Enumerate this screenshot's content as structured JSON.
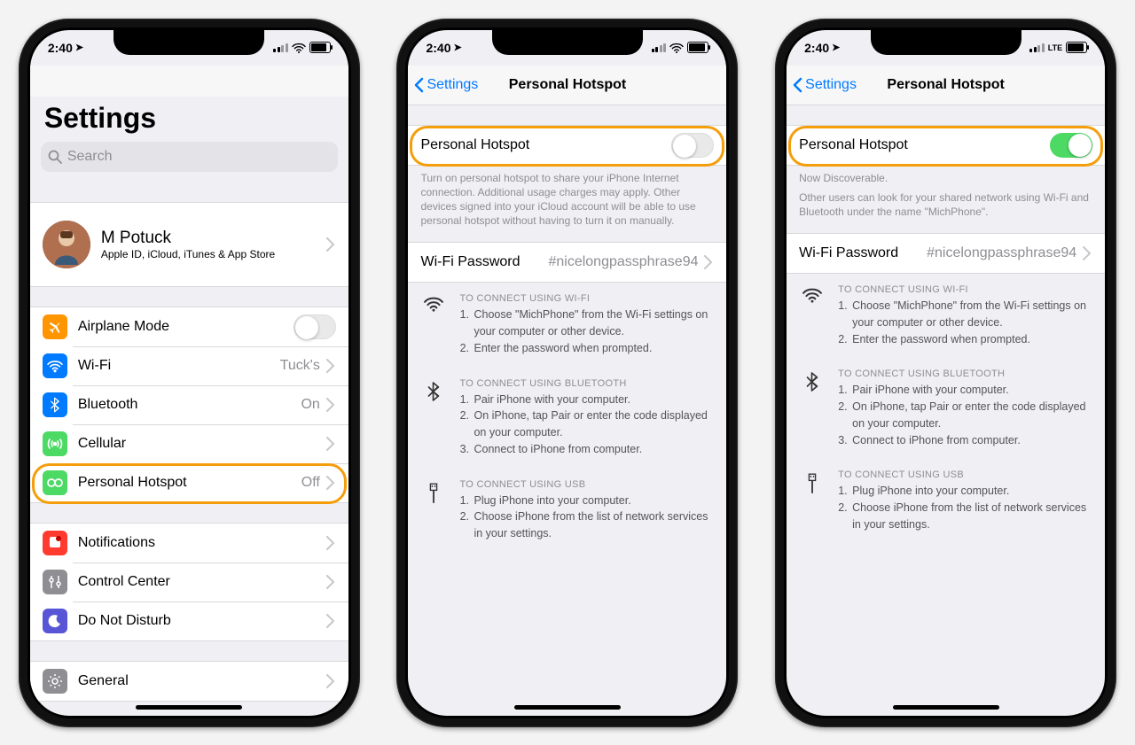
{
  "statusbar": {
    "time": "2:40"
  },
  "settings": {
    "title": "Settings",
    "search_placeholder": "Search",
    "profile": {
      "name": "M Potuck",
      "subtitle": "Apple ID, iCloud, iTunes & App Store"
    },
    "items": {
      "airplane": "Airplane Mode",
      "wifi": "Wi-Fi",
      "wifi_value": "Tuck's",
      "bluetooth": "Bluetooth",
      "bluetooth_value": "On",
      "cellular": "Cellular",
      "hotspot": "Personal Hotspot",
      "hotspot_value": "Off",
      "notifications": "Notifications",
      "controlcenter": "Control Center",
      "dnd": "Do Not Disturb",
      "general": "General"
    }
  },
  "hotspot": {
    "back": "Settings",
    "title": "Personal Hotspot",
    "toggle_label": "Personal Hotspot",
    "off_footer": "Turn on personal hotspot to share your iPhone Internet connection. Additional usage charges may apply. Other devices signed into your iCloud account will be able to use personal hotspot without having to turn it on manually.",
    "on_footer1": "Now Discoverable.",
    "on_footer2": "Other users can look for your shared network using Wi-Fi and Bluetooth under the name \"MichPhone\".",
    "wifi_password_label": "Wi-Fi Password",
    "wifi_password_value": "#nicelongpassphrase94",
    "instructions": {
      "wifi": {
        "hd": "TO CONNECT USING WI-FI",
        "steps": [
          "Choose \"MichPhone\" from the Wi-Fi settings on your computer or other device.",
          "Enter the password when prompted."
        ]
      },
      "bluetooth": {
        "hd": "TO CONNECT USING BLUETOOTH",
        "steps": [
          "Pair iPhone with your computer.",
          "On iPhone, tap Pair or enter the code displayed on your computer.",
          "Connect to iPhone from computer."
        ]
      },
      "usb": {
        "hd": "TO CONNECT USING USB",
        "steps": [
          "Plug iPhone into your computer.",
          "Choose iPhone from the list of network services in your settings."
        ]
      }
    }
  },
  "lte_label": "LTE"
}
